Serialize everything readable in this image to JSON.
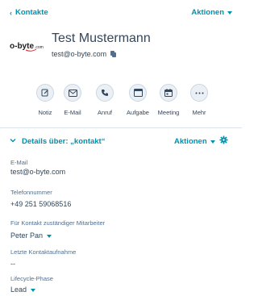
{
  "header": {
    "back_label": "Kontakte",
    "actions_label": "Aktionen"
  },
  "contact": {
    "logo_text": "o-byte",
    "logo_subtext": ".com",
    "name": "Test Mustermann",
    "email": "test@o-byte.com"
  },
  "quick_actions": [
    {
      "label": "Notiz",
      "icon": "note-icon"
    },
    {
      "label": "E-Mail",
      "icon": "email-icon"
    },
    {
      "label": "Anruf",
      "icon": "phone-icon"
    },
    {
      "label": "Aufgabe",
      "icon": "task-icon"
    },
    {
      "label": "Meeting",
      "icon": "calendar-icon"
    },
    {
      "label": "Mehr",
      "icon": "more-icon"
    }
  ],
  "details": {
    "title": "Details über: „kontakt“",
    "actions_label": "Aktionen",
    "properties": [
      {
        "label": "E-Mail",
        "value": "test@o-byte.com",
        "dropdown": false
      },
      {
        "label": "Telefonnummer",
        "value": "+49 251 59068516",
        "dropdown": false
      },
      {
        "label": "Für Kontakt zuständiger Mitarbeiter",
        "value": "Peter Pan",
        "dropdown": true
      },
      {
        "label": "Letzte Kontaktaufnahme",
        "value": "--",
        "dropdown": false
      },
      {
        "label": "Lifecycle-Phase",
        "value": "Lead",
        "dropdown": true
      }
    ]
  },
  "colors": {
    "link": "#0091ae",
    "text": "#33475b",
    "muted": "#516f90",
    "icon_bg": "#eaf0f6",
    "icon_border": "#cbd6e2"
  }
}
